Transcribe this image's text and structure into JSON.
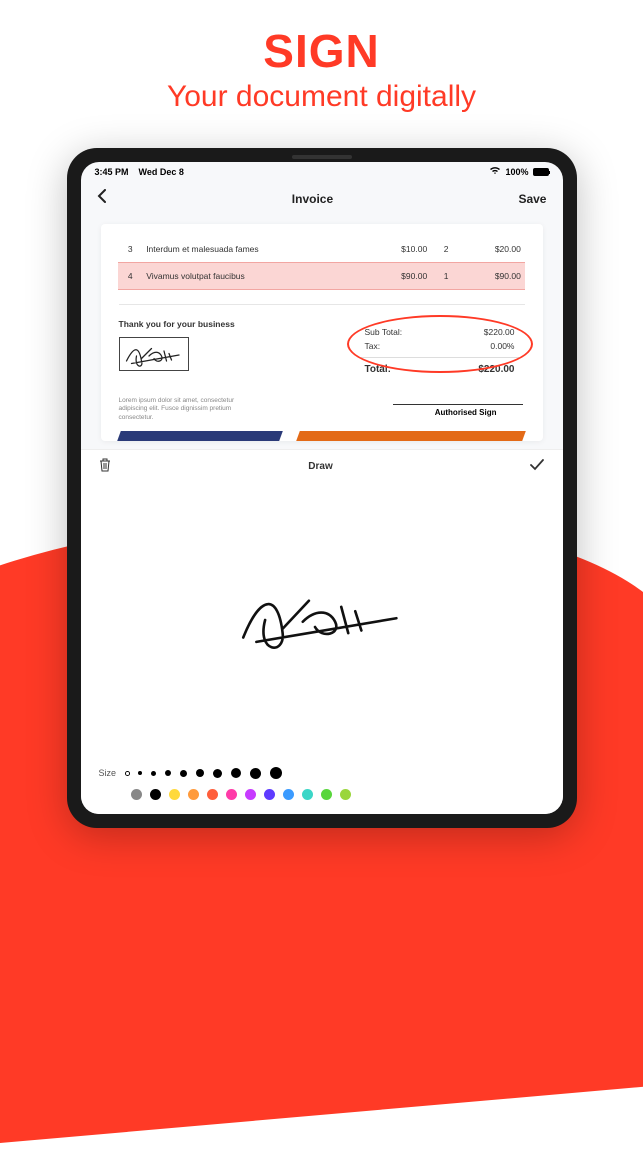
{
  "headline": {
    "title": "SIGN",
    "subtitle": "Your document digitally"
  },
  "statusbar": {
    "time": "3:45 PM",
    "date": "Wed Dec 8",
    "battery": "100%"
  },
  "navbar": {
    "title": "Invoice",
    "save": "Save"
  },
  "invoice": {
    "rows": [
      {
        "n": "3",
        "desc": "Interdum et malesuada fames",
        "price": "$10.00",
        "qty": "2",
        "line": "$20.00",
        "hl": false
      },
      {
        "n": "4",
        "desc": "Vivamus volutpat faucibus",
        "price": "$90.00",
        "qty": "1",
        "line": "$90.00",
        "hl": true
      }
    ],
    "thanks": "Thank you for your business",
    "subtotal_label": "Sub Total:",
    "subtotal": "$220.00",
    "tax_label": "Tax:",
    "tax": "0.00%",
    "total_label": "Total:",
    "total": "$220.00",
    "footnote": "Lorem ipsum dolor sit amet, consectetur adipiscing elit. Fusce dignissim pretium consectetur.",
    "authsign": "Authorised Sign"
  },
  "draw": {
    "label": "Draw",
    "size_label": "Size"
  },
  "sizes": [
    3,
    4,
    5,
    6,
    7,
    8,
    9,
    10,
    11,
    12
  ],
  "colors": [
    "#888888",
    "#000000",
    "#ffd93b",
    "#ff9a3b",
    "#ff5e3b",
    "#ff3ba8",
    "#c73bff",
    "#5e3bff",
    "#3b9bff",
    "#3bd6c7",
    "#58d63b",
    "#9ad63b"
  ]
}
